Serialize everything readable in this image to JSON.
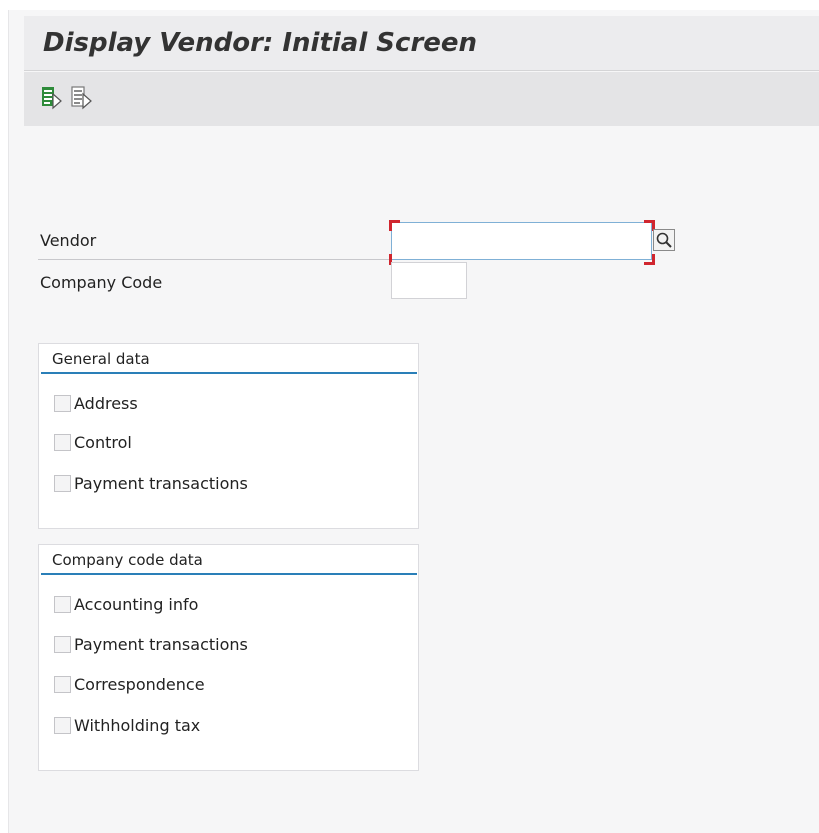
{
  "title": "Display Vendor:  Initial Screen",
  "toolbar": {
    "icons": [
      "execute-list-icon",
      "display-list-icon"
    ]
  },
  "fields": {
    "vendor": {
      "label": "Vendor",
      "value": "",
      "placeholder": ""
    },
    "company_code": {
      "label": "Company Code",
      "value": "",
      "placeholder": ""
    }
  },
  "general_data": {
    "title": "General data",
    "items": [
      {
        "label": "Address",
        "checked": false
      },
      {
        "label": "Control",
        "checked": false
      },
      {
        "label": "Payment transactions",
        "checked": false
      }
    ]
  },
  "company_code_data": {
    "title": "Company code data",
    "items": [
      {
        "label": "Accounting info",
        "checked": false
      },
      {
        "label": "Payment transactions",
        "checked": false
      },
      {
        "label": "Correspondence",
        "checked": false
      },
      {
        "label": "Withholding tax",
        "checked": false
      }
    ]
  },
  "colors": {
    "title_bar": "#ececee",
    "toolbar": "#e4e4e6",
    "accent_rule": "#2a7fb8",
    "focus": "#d0262f",
    "icon_green": "#2e8b3a"
  }
}
